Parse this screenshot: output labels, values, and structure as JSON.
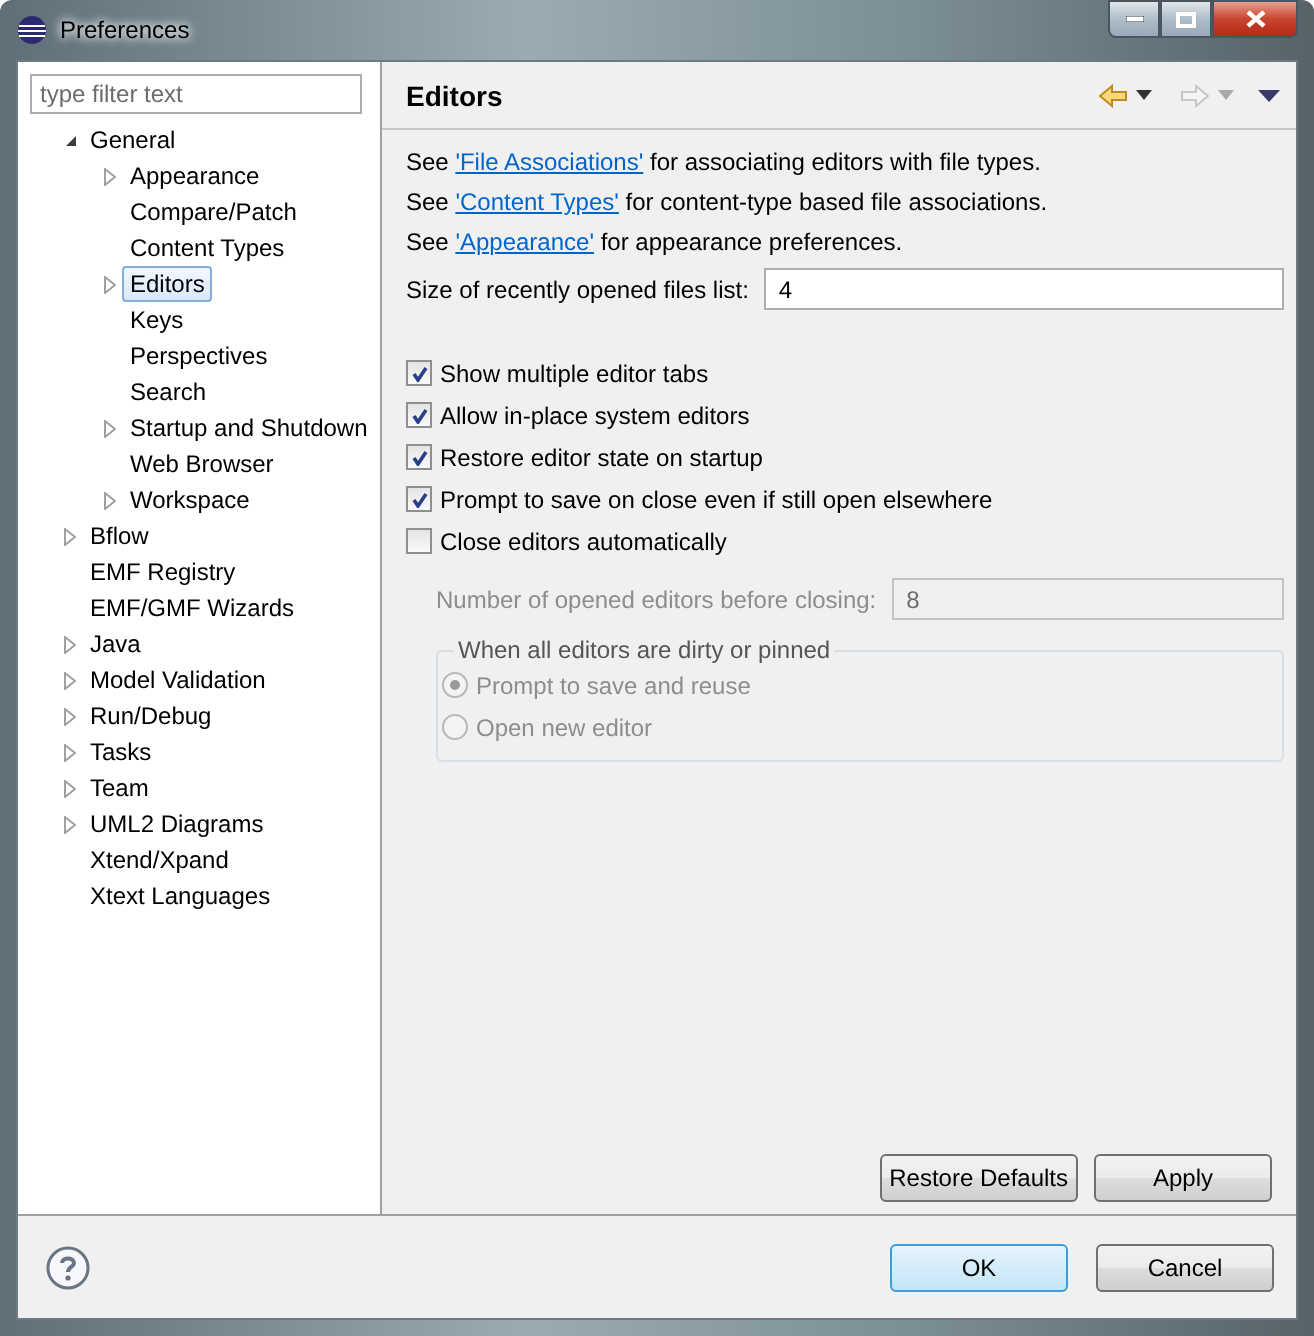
{
  "window": {
    "title": "Preferences"
  },
  "filter": {
    "placeholder": "type filter text"
  },
  "tree": [
    {
      "label": "General",
      "expanded": true,
      "selected": false,
      "children": [
        {
          "label": "Appearance",
          "expanded": false,
          "selected": false
        },
        {
          "label": "Compare/Patch",
          "selected": false
        },
        {
          "label": "Content Types",
          "selected": false
        },
        {
          "label": "Editors",
          "expanded": false,
          "selected": true
        },
        {
          "label": "Keys",
          "selected": false
        },
        {
          "label": "Perspectives",
          "selected": false
        },
        {
          "label": "Search",
          "selected": false
        },
        {
          "label": "Startup and Shutdown",
          "expanded": false,
          "selected": false
        },
        {
          "label": "Web Browser",
          "selected": false
        },
        {
          "label": "Workspace",
          "expanded": false,
          "selected": false
        }
      ]
    },
    {
      "label": "Bflow",
      "expanded": false,
      "selected": false
    },
    {
      "label": "EMF Registry",
      "selected": false
    },
    {
      "label": "EMF/GMF Wizards",
      "selected": false
    },
    {
      "label": "Java",
      "expanded": false,
      "selected": false
    },
    {
      "label": "Model Validation",
      "expanded": false,
      "selected": false
    },
    {
      "label": "Run/Debug",
      "expanded": false,
      "selected": false
    },
    {
      "label": "Tasks",
      "expanded": false,
      "selected": false
    },
    {
      "label": "Team",
      "expanded": false,
      "selected": false
    },
    {
      "label": "UML2 Diagrams",
      "expanded": false,
      "selected": false
    },
    {
      "label": "Xtend/Xpand",
      "selected": false
    },
    {
      "label": "Xtext Languages",
      "selected": false
    }
  ],
  "page": {
    "title": "Editors",
    "nav": {
      "back_enabled": true,
      "forward_enabled": false
    },
    "links": [
      {
        "before": "See ",
        "link": "'File Associations'",
        "after": " for associating editors with file types."
      },
      {
        "before": "See ",
        "link": "'Content Types'",
        "after": " for content-type based file associations."
      },
      {
        "before": "See ",
        "link": "'Appearance'",
        "after": " for appearance preferences."
      }
    ],
    "recent_field": {
      "label": "Size of recently opened files list:",
      "value": "4"
    },
    "checkboxes": [
      {
        "label": "Show multiple editor tabs",
        "checked": true
      },
      {
        "label": "Allow in-place system editors",
        "checked": true
      },
      {
        "label": "Restore editor state on startup",
        "checked": true
      },
      {
        "label": "Prompt to save on close even if still open elsewhere",
        "checked": true
      },
      {
        "label": "Close editors automatically",
        "checked": false
      }
    ],
    "close_field": {
      "label": "Number of opened editors before closing:",
      "value": "8",
      "disabled": true
    },
    "group": {
      "title": "When all editors are dirty or pinned",
      "disabled": true,
      "options": [
        {
          "label": "Prompt to save and reuse",
          "selected": true
        },
        {
          "label": "Open new editor",
          "selected": false
        }
      ]
    },
    "buttons": [
      "Restore Defaults",
      "Apply"
    ]
  },
  "dialog_buttons": [
    {
      "label": "OK",
      "default": true
    },
    {
      "label": "Cancel",
      "default": false
    }
  ]
}
